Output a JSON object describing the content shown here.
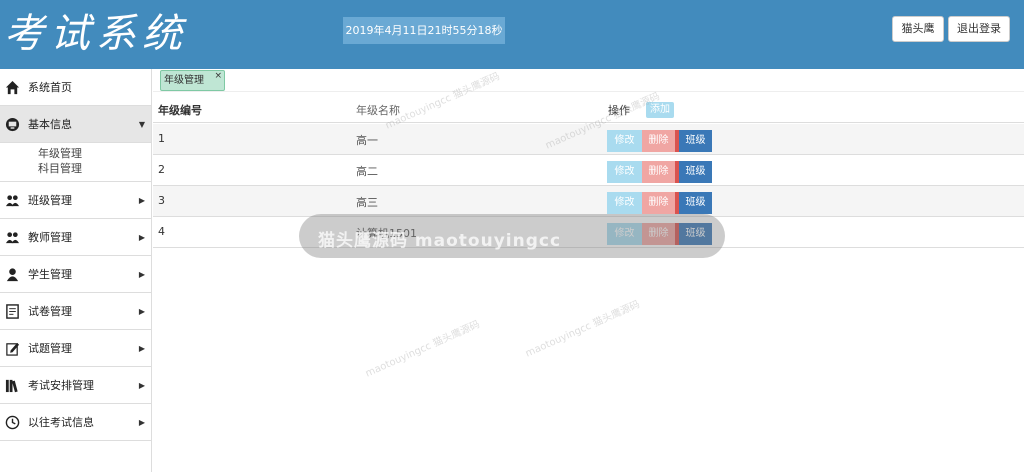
{
  "header": {
    "title": "考试系统",
    "datetime": "2019年4月11日21时55分18秒",
    "user_button": "猫头鹰",
    "logout_button": "退出登录"
  },
  "sidebar": {
    "items": [
      {
        "label": "系统首页",
        "icon": "home-icon"
      },
      {
        "label": "基本信息",
        "icon": "monitor-icon",
        "expanded": true,
        "children": [
          "年级管理",
          "科目管理"
        ]
      },
      {
        "label": "班级管理",
        "icon": "users-icon"
      },
      {
        "label": "教师管理",
        "icon": "users-icon"
      },
      {
        "label": "学生管理",
        "icon": "user-icon"
      },
      {
        "label": "试卷管理",
        "icon": "document-icon"
      },
      {
        "label": "试题管理",
        "icon": "edit-icon"
      },
      {
        "label": "考试安排管理",
        "icon": "books-icon"
      },
      {
        "label": "以往考试信息",
        "icon": "clock-icon"
      }
    ]
  },
  "tabs": [
    {
      "label": "年级管理",
      "close": "×"
    }
  ],
  "table": {
    "headers": {
      "id": "年级编号",
      "name": "年级名称",
      "op": "操作"
    },
    "add_label": "添加",
    "rows": [
      {
        "id": "1",
        "name": "高一"
      },
      {
        "id": "2",
        "name": "高二"
      },
      {
        "id": "3",
        "name": "高三"
      },
      {
        "id": "4",
        "name": "计算机1501"
      }
    ],
    "actions": {
      "edit": "修改",
      "delete": "删除",
      "class": "班级"
    }
  },
  "watermark": {
    "banner": "猫头鹰源码 maotouyingcc",
    "diag": "maotouyingcc 猫头鹰源码"
  },
  "colors": {
    "header": "#428bbd",
    "accent_blue": "#3a78b7",
    "danger": "#f0a6a3",
    "info": "#a9dbef"
  }
}
